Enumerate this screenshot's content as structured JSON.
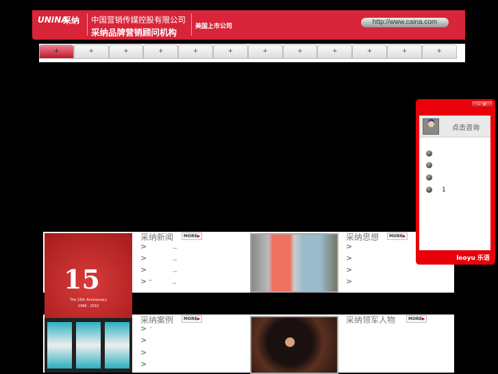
{
  "header": {
    "logo_en": "UNINA",
    "logo_cn": "采纳",
    "company_line1": "中国营销传媒控股有限公司",
    "company_line2": "采纳品牌营销顾问机构",
    "listed": "美国上市公司",
    "url": "http://www.caina.com"
  },
  "nav": {
    "tabs": [
      "+",
      "+",
      "+",
      "+",
      "+",
      "+",
      "+",
      "+",
      "+",
      "+",
      "+",
      "+"
    ]
  },
  "banner": {
    "number": "15",
    "anniversary": "The 15th Anniversary",
    "years": "1996 - 2010"
  },
  "sections": [
    {
      "title": "采纳新闻",
      "more": "MORE",
      "items": [
        {
          "arrow": ">",
          "text": "..",
          "prefix": ""
        },
        {
          "arrow": ">",
          "text": "..",
          "prefix": ""
        },
        {
          "arrow": ">",
          "text": "..",
          "prefix": ""
        },
        {
          "arrow": ">",
          "text": "..",
          "prefix": "\""
        }
      ]
    },
    {
      "title": "采纳思想",
      "more": "MORE",
      "items": [
        {
          "arrow": ">"
        },
        {
          "arrow": ">"
        },
        {
          "arrow": ">"
        },
        {
          "arrow": ">"
        }
      ]
    },
    {
      "title": "采纳案例",
      "more": "MORE",
      "items": [
        {
          "arrow": ">",
          "prefix": "'"
        },
        {
          "arrow": ">"
        },
        {
          "arrow": ">"
        },
        {
          "arrow": ">"
        }
      ]
    },
    {
      "title": "采纳领军人物",
      "more": "MORE"
    }
  ],
  "chat": {
    "controls": "– ×",
    "consult": "点击咨询",
    "agents": [
      "",
      "",
      "",
      "1"
    ],
    "brand": "leoyu 乐语"
  }
}
